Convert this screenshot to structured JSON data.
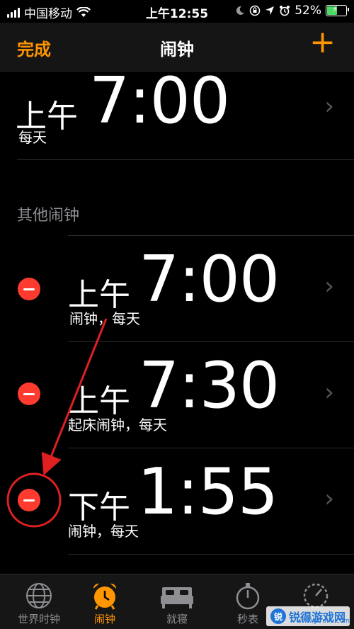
{
  "status": {
    "carrier": "中国移动",
    "time": "上午12:55",
    "battery": "52%",
    "battery_level": 0.52
  },
  "nav": {
    "done": "完成",
    "title": "闹钟",
    "add": "+"
  },
  "alarms": [
    {
      "ampm": "上午",
      "time": "7:00",
      "label": "每天"
    }
  ],
  "other_header": "其他闹钟",
  "other_alarms": [
    {
      "ampm": "上午",
      "time": "7:00",
      "label": "闹钟，每天"
    },
    {
      "ampm": "上午",
      "time": "7:30",
      "label": "起床闹钟，每天"
    },
    {
      "ampm": "下午",
      "time": "1:55",
      "label": "闹钟，每天"
    }
  ],
  "tabs": [
    {
      "label": "世界时钟",
      "icon": "globe-icon"
    },
    {
      "label": "闹钟",
      "icon": "alarm-clock-icon"
    },
    {
      "label": "就寝",
      "icon": "bed-icon"
    },
    {
      "label": "秒表",
      "icon": "stopwatch-icon"
    },
    {
      "label": "",
      "icon": "timer-icon"
    }
  ],
  "watermark": {
    "logo": "锐",
    "text": "锐得游戏网",
    "url": "www.ytruilu.com"
  },
  "colors": {
    "accent": "#ff9500",
    "delete": "#ff3b30",
    "annotation": "#e02020"
  }
}
